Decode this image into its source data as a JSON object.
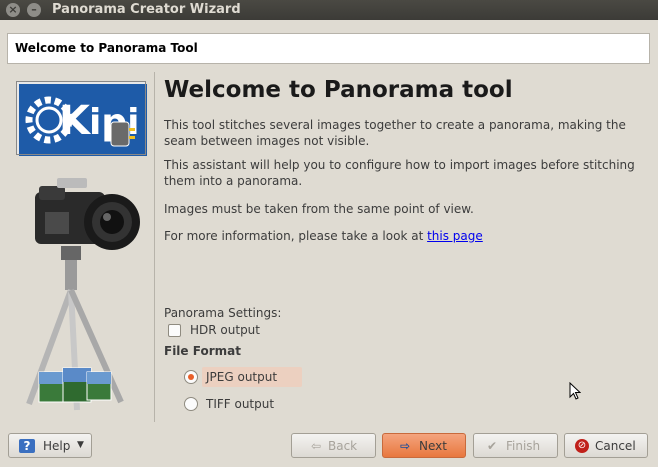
{
  "window": {
    "title": "Panorama Creator Wizard"
  },
  "header": {
    "title": "Welcome to Panorama Tool"
  },
  "sidebar": {
    "logo_text": "kipi"
  },
  "content": {
    "title": "Welcome to Panorama tool",
    "p1": "This tool stitches several images together to create a panorama, making the seam between images not visible.",
    "p2": "This assistant will help you to configure how to import images before stitching them into a panorama.",
    "p3": "Images must be taken from the same point of view.",
    "p4_prefix": "For more information, please take a look at ",
    "p4_link": "this page"
  },
  "settings": {
    "label": "Panorama Settings:",
    "hdr_label": "HDR output",
    "hdr_checked": false,
    "format_label": "File Format",
    "jpeg_label": "JPEG output",
    "tiff_label": "TIFF output",
    "selected_format": "JPEG output"
  },
  "buttons": {
    "help": "Help",
    "back": "Back",
    "next": "Next",
    "finish": "Finish",
    "cancel": "Cancel"
  },
  "colors": {
    "accent": "#e8773e",
    "window_bg": "#dfdbd2",
    "titlebar": "#3c3b37",
    "logo_blue": "#1e5ba8"
  }
}
